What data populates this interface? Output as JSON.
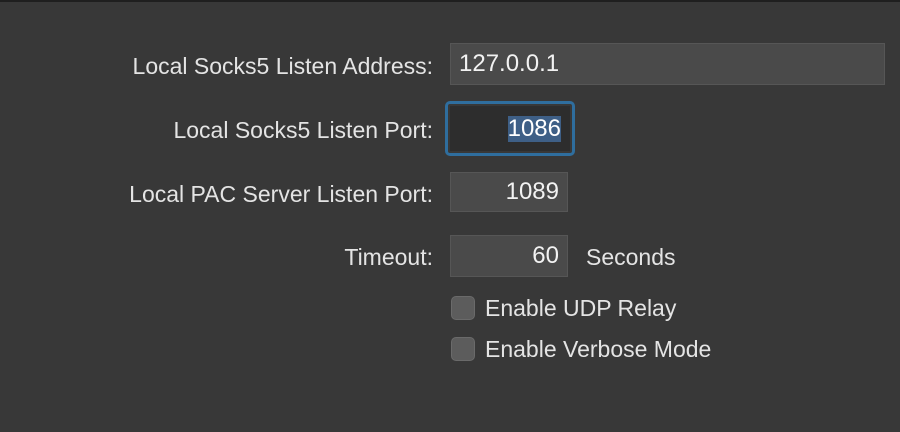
{
  "form": {
    "address": {
      "label": "Local Socks5 Listen Address:",
      "value": "127.0.0.1"
    },
    "port": {
      "label": "Local Socks5 Listen Port:",
      "value": "1086",
      "focused": true,
      "selected": true
    },
    "pac_port": {
      "label": "Local PAC Server Listen Port:",
      "value": "1089"
    },
    "timeout": {
      "label": "Timeout:",
      "value": "60",
      "unit": "Seconds"
    },
    "udp_relay": {
      "label": "Enable UDP Relay",
      "checked": false
    },
    "verbose": {
      "label": "Enable Verbose Mode",
      "checked": false
    }
  },
  "colors": {
    "background": "#383838",
    "field_background": "#4a4a4a",
    "focus_ring": "#2f6e9e",
    "selection": "#3e5f86"
  }
}
